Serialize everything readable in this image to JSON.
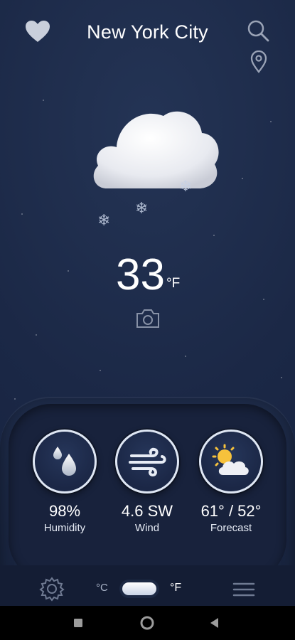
{
  "header": {
    "city": "New York City"
  },
  "current": {
    "temperature": "33",
    "unit": "°F"
  },
  "widgets": [
    {
      "value": "98%",
      "label": "Humidity",
      "icon": "water-drops-icon"
    },
    {
      "value": "4.6 SW",
      "label": "Wind",
      "icon": "wind-icon"
    },
    {
      "value": "61° / 52°",
      "label": "Forecast",
      "icon": "partly-cloudy-icon"
    }
  ],
  "units": {
    "celsius": "°C",
    "fahrenheit": "°F",
    "selected": "fahrenheit"
  },
  "colors": {
    "background": "#1b2846",
    "panel": "#18223c",
    "text": "#ffffff"
  }
}
